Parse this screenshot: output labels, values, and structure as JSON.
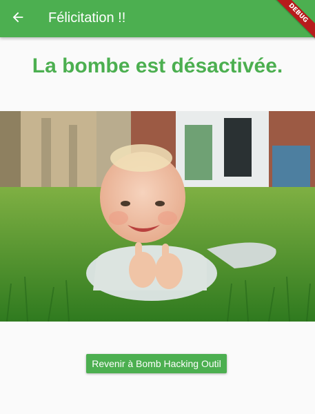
{
  "app_bar": {
    "title": "Félicitation !!",
    "back_icon": "arrow-back-icon",
    "background": "#4caf50"
  },
  "debug_banner": {
    "label": "DEBUG",
    "color": "#b71c1c"
  },
  "main": {
    "headline": "La bombe est désactivée.",
    "headline_color": "#4caf50",
    "image_description": "baby",
    "button_label": "Revenir à Bomb Hacking Outil"
  }
}
